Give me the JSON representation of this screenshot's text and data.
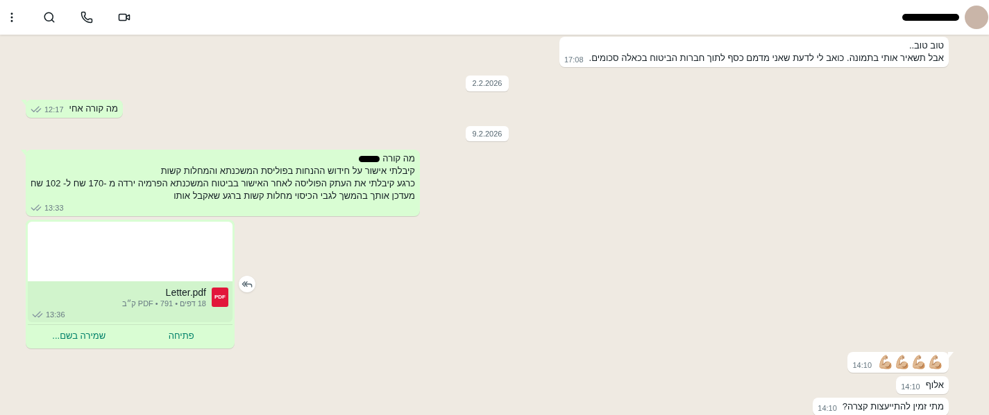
{
  "header": {
    "contact_name_redacted": true,
    "actions": [
      {
        "kind": "video"
      },
      {
        "kind": "call"
      },
      {
        "kind": "search"
      },
      {
        "kind": "menu"
      }
    ]
  },
  "messages": [
    {
      "kind": "text",
      "outgoing": false,
      "tail": false,
      "lines": [
        {
          "text": "טוב טוב..",
          "redacted": false
        },
        {
          "text": "אבל תשאיר אותי בתמונה. כואב לי לדעת שאני מדמם כסף לתוך חברות הביטוח בכאלה סכומים.",
          "redacted": false
        }
      ],
      "time": "17:08"
    },
    {
      "kind": "date",
      "text": "2.2.2026"
    },
    {
      "kind": "text",
      "outgoing": true,
      "tail": true,
      "read": false,
      "lines": [
        {
          "text": "מה קורה אחי",
          "redacted": false
        }
      ],
      "time": "12:17"
    },
    {
      "kind": "date",
      "text": "9.2.2026"
    },
    {
      "kind": "text",
      "outgoing": true,
      "tail": true,
      "read": false,
      "lines": [
        {
          "text": "מה קורה",
          "redacted": true
        },
        {
          "text": "קיבלתי אישור על חידוש ההנחות בפוליסת המשכנתא והמחלות קשות",
          "redacted": false
        },
        {
          "text": "כרגע קיבלתי את העתק הפוליסה לאחר האישור בביטוח המשכנתא הפרמיה ירדה מ -170 שח ל- 102 שח",
          "redacted": false
        },
        {
          "text": "מעדכן אותך בהמשך לגבי הכיסוי מחלות קשות ברגע שאקבל אותו",
          "redacted": false
        }
      ],
      "time": "13:33"
    },
    {
      "kind": "document",
      "outgoing": true,
      "read": false,
      "file_name": "Letter.pdf",
      "meta": "18 דפים • PDF • 791 ק״ב",
      "file_type": "PDF",
      "time": "13:36",
      "actions": [
        "פתיחה",
        "שמירה בשם..."
      ],
      "forward": true
    },
    {
      "kind": "emoji",
      "outgoing": false,
      "tail": true,
      "text": "💪🏼💪🏼💪🏼💪🏼",
      "time": "14:10"
    },
    {
      "kind": "text",
      "outgoing": false,
      "tail": false,
      "lines": [
        {
          "text": "אלוף",
          "redacted": false
        }
      ],
      "time": "14:10"
    },
    {
      "kind": "text",
      "outgoing": false,
      "tail": false,
      "lines": [
        {
          "text": "מתי זמין להתייעצות קצרה?",
          "redacted": false
        }
      ],
      "time": "14:10"
    }
  ]
}
